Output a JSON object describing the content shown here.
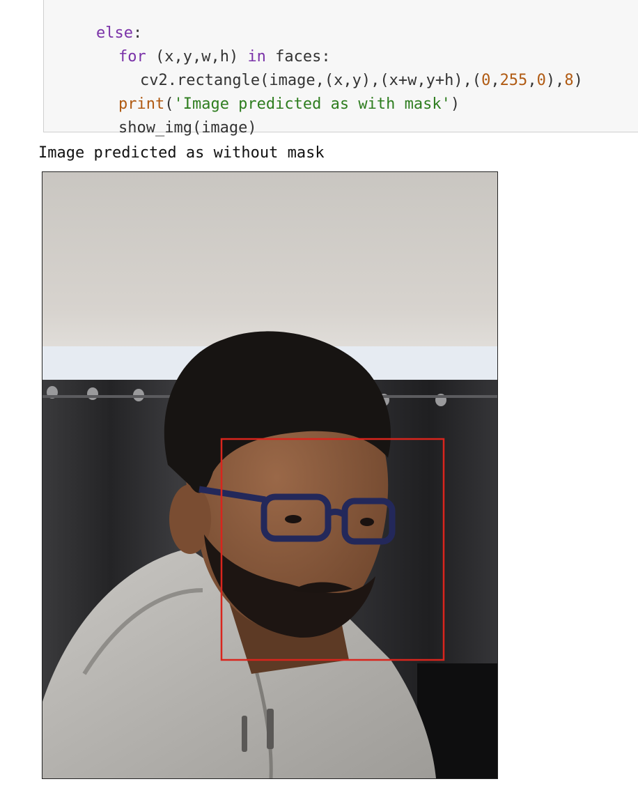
{
  "code_cell": {
    "lines": [
      {
        "kw": "else",
        "rest": ":"
      },
      {
        "kw": "for",
        "pre": "(x,y,w,h) ",
        "kw2": "in",
        "post": " faces:"
      },
      {
        "text": "cv2.rectangle(image,(x,y),(x+w,y+h),(",
        "n1": "0",
        "c1": ",",
        "n2": "255",
        "c2": ",",
        "n3": "0",
        "c3": "),",
        "n4": "8",
        "end": ")"
      },
      {
        "fn": "print",
        "open": "(",
        "str": "'Image predicted as with mask'",
        "close": ")"
      },
      {
        "text": "show_img(image)"
      }
    ]
  },
  "output": {
    "text": "Image predicted as without mask"
  },
  "photo": {
    "subject": "person-with-glasses-and-beard",
    "colors": {
      "ceiling": "#cfcac4",
      "light_strip": "#eef2f7",
      "curtain": "#2c2c2e",
      "hair": "#161412",
      "skin": "#8a5a3c",
      "hoodie": "#b9b7b3",
      "glasses": "#23285a",
      "face_box": "#d9251d"
    }
  }
}
